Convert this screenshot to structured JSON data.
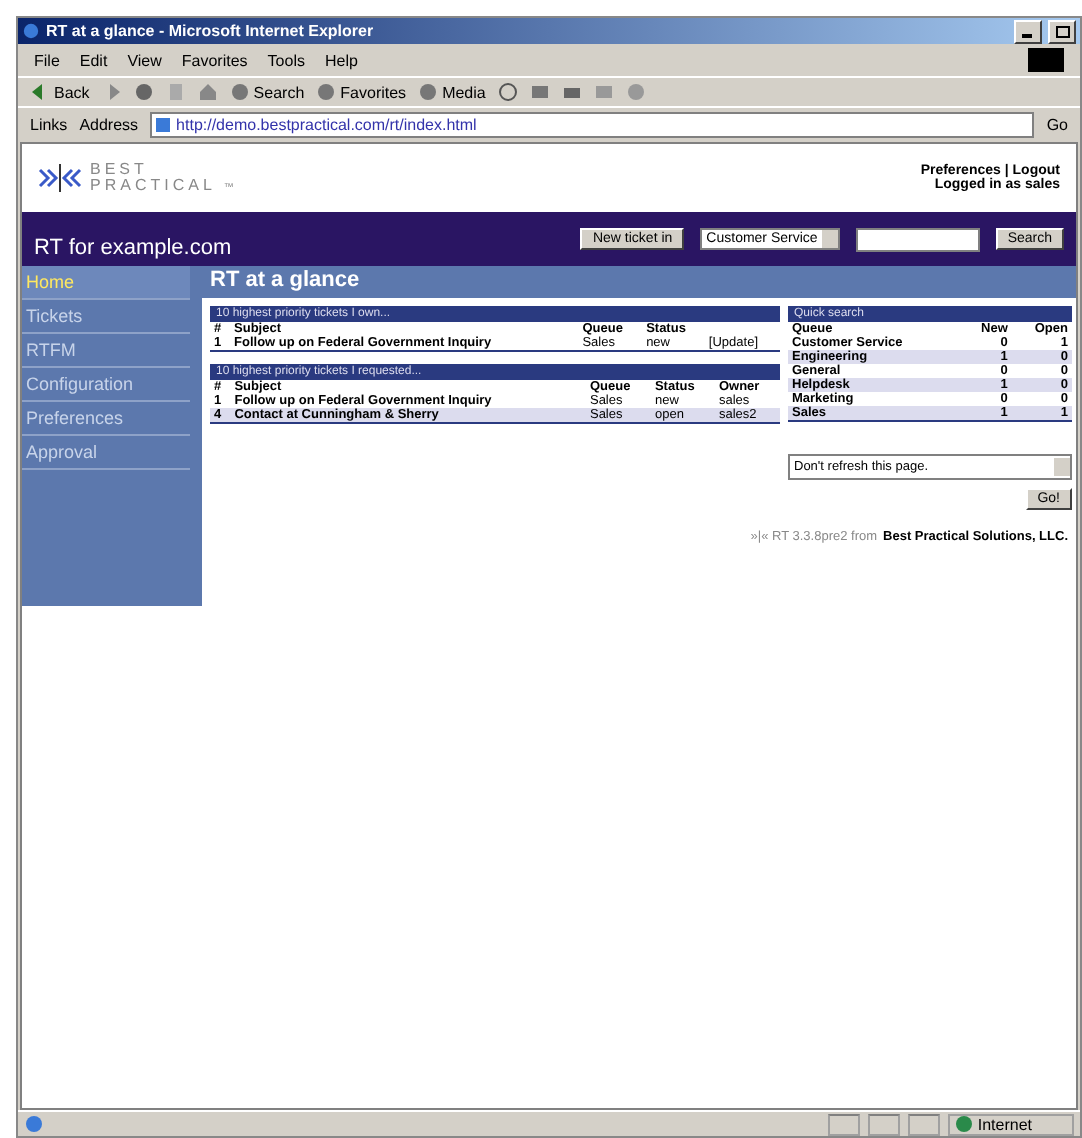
{
  "window": {
    "title": "RT at a glance - Microsoft Internet Explorer"
  },
  "menu": [
    "File",
    "Edit",
    "View",
    "Favorites",
    "Tools",
    "Help"
  ],
  "toolbar": {
    "back": "Back",
    "buttons": [
      "Search",
      "Favorites",
      "Media"
    ]
  },
  "address_bar": {
    "links": "Links",
    "label": "Address",
    "url": "http://demo.bestpractical.com/rt/index.html",
    "go": "Go"
  },
  "header": {
    "logo": [
      "BEST",
      "PRACTICAL",
      "™"
    ],
    "links": [
      "Preferences",
      "Logout"
    ],
    "separator": "|",
    "logged_in": "Logged in as sales",
    "site": "RT for example.com",
    "new_ticket": "New ticket in",
    "queue": "Customer Service",
    "search": "Search"
  },
  "sidebar": {
    "items": [
      {
        "label": "Home",
        "selected": true
      },
      {
        "label": "Tickets",
        "selected": false
      },
      {
        "label": "RTFM",
        "selected": false
      },
      {
        "label": "Configuration",
        "selected": false
      },
      {
        "label": "Preferences",
        "selected": false
      },
      {
        "label": "Approval",
        "selected": false
      }
    ]
  },
  "page_title": "RT at a glance",
  "panels": [
    {
      "title": "10 highest priority tickets I own...",
      "columns": [
        "#",
        "Subject",
        "Queue",
        "Status"
      ],
      "rows": [
        [
          "1",
          "Follow up on Federal Government Inquiry",
          "Sales",
          "new",
          "[Update]"
        ]
      ]
    },
    {
      "title": "10 highest priority tickets I requested...",
      "columns": [
        "#",
        "Subject",
        "Queue",
        "Status",
        "Owner"
      ],
      "rows": [
        [
          "1",
          "Follow up on Federal Government Inquiry",
          "Sales",
          "new",
          "sales"
        ],
        [
          "4",
          "Contact at Cunningham & Sherry",
          "Sales",
          "open",
          "sales2"
        ]
      ]
    }
  ],
  "quick_search": {
    "title": "Quick search",
    "columns": [
      "Queue",
      "New",
      "Open"
    ],
    "rows": [
      [
        "Customer Service",
        "0",
        "1"
      ],
      [
        "Engineering",
        "1",
        "0"
      ],
      [
        "General",
        "0",
        "0"
      ],
      [
        "Helpdesk",
        "1",
        "0"
      ],
      [
        "Marketing",
        "0",
        "0"
      ],
      [
        "Sales",
        "1",
        "1"
      ]
    ]
  },
  "refresh": {
    "value": "Don't refresh this page.",
    "go": "Go!"
  },
  "footer": {
    "version": "»|« RT 3.3.8pre2 from",
    "vendor": "Best Practical Solutions, LLC."
  },
  "status_bar": {
    "zone": "Internet"
  }
}
